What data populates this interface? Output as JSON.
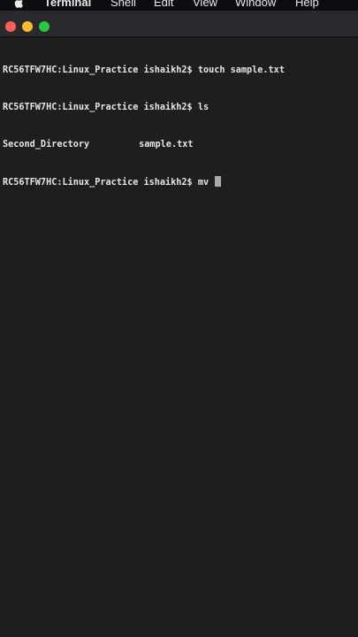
{
  "menubar": {
    "app_name": "Terminal",
    "items": [
      "Shell",
      "Edit",
      "View",
      "Window",
      "Help"
    ]
  },
  "terminal": {
    "lines": [
      {
        "prompt": "RC56TFW7HC:Linux_Practice ishaikh2$",
        "command": "touch sample.txt"
      },
      {
        "prompt": "RC56TFW7HC:Linux_Practice ishaikh2$",
        "command": "ls"
      }
    ],
    "ls_output": [
      "Second_Directory",
      "sample.txt"
    ],
    "current": {
      "prompt": "RC56TFW7HC:Linux_Practice ishaikh2$",
      "command": "mv"
    }
  },
  "colors": {
    "close": "#ff5f57",
    "minimize": "#febc2e",
    "maximize": "#28c840",
    "background": "#1e1e1e",
    "text": "#e6e6e6"
  }
}
